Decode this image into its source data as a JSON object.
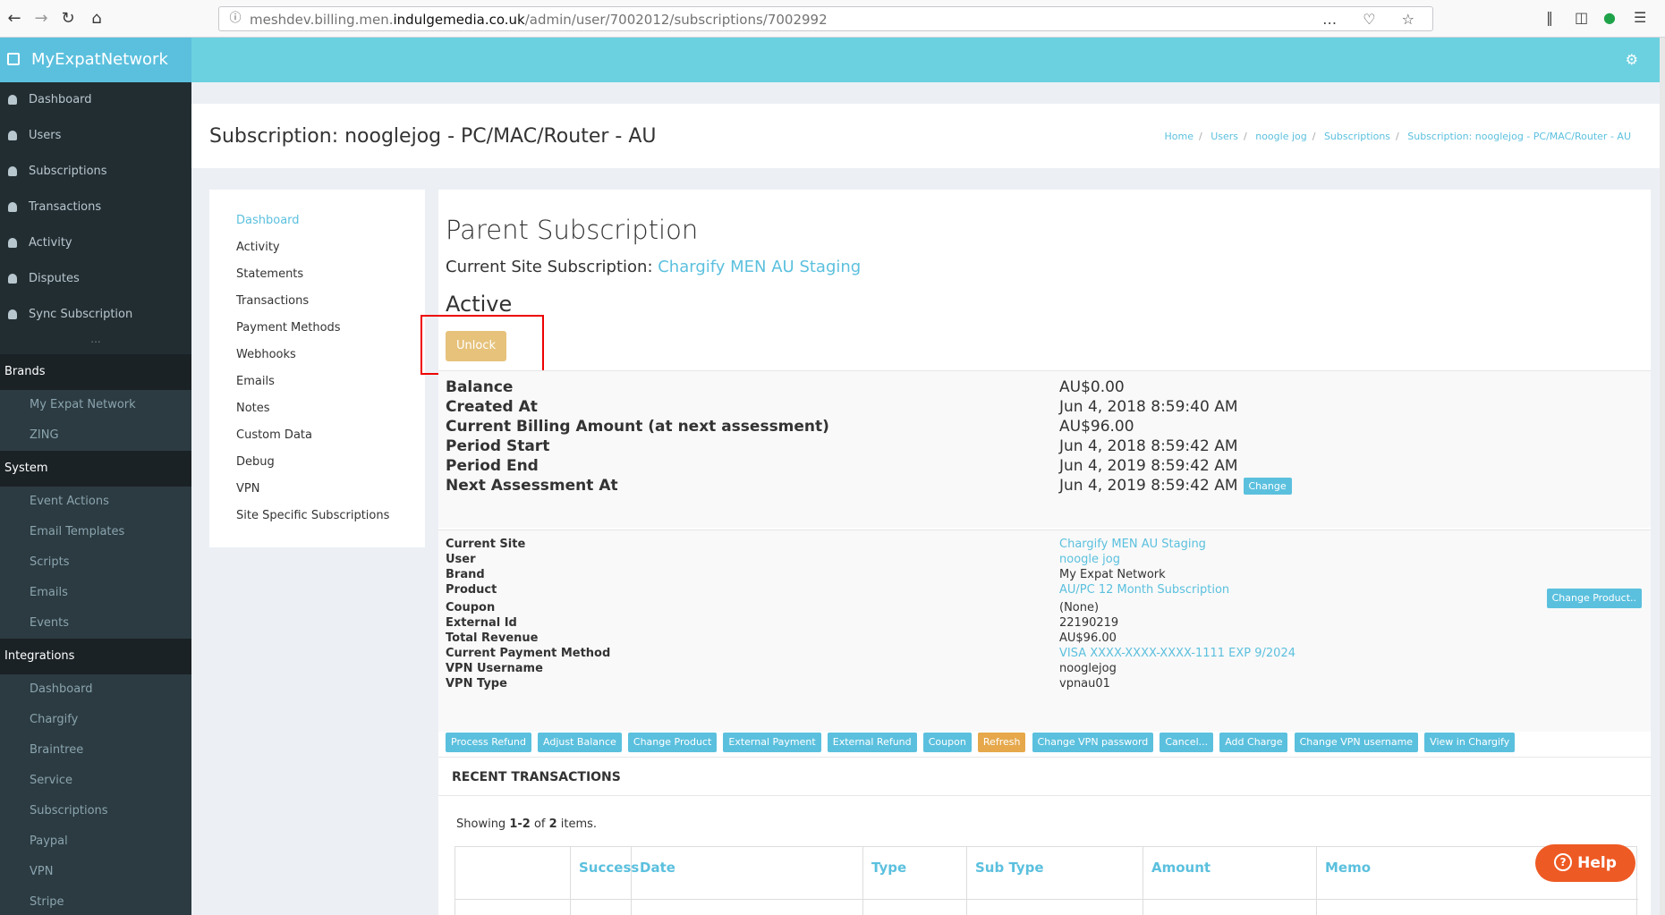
{
  "browser": {
    "url_prefix": "meshdev.billing.men.",
    "url_domain": "indulgemedia.co.uk",
    "url_path": "/admin/user/7002012/subscriptions/7002992",
    "more_icon": "…",
    "pocket_icon": "♡",
    "star_icon": "☆"
  },
  "sidebar": {
    "brand": "MyExpatNetwork",
    "items": [
      "Dashboard",
      "Users",
      "Subscriptions",
      "Transactions",
      "Activity",
      "Disputes",
      "Sync Subscription"
    ],
    "dots": "...",
    "brands_header": "Brands",
    "brands": [
      "My Expat Network",
      "ZING"
    ],
    "system_header": "System",
    "system": [
      "Event Actions",
      "Email Templates",
      "Scripts",
      "Emails",
      "Events"
    ],
    "integrations_header": "Integrations",
    "integrations": [
      "Dashboard",
      "Chargify",
      "Braintree",
      "Service",
      "Subscriptions",
      "Paypal",
      "VPN",
      "Stripe"
    ]
  },
  "header": {
    "title": "Subscription: nooglejog - PC/MAC/Router - AU",
    "breadcrumb": [
      "Home",
      "Users",
      "noogle jog",
      "Subscriptions",
      "Subscription: nooglejog - PC/MAC/Router - AU"
    ],
    "breadcrumb_sep": "/"
  },
  "subnav": [
    "Dashboard",
    "Activity",
    "Statements",
    "Transactions",
    "Payment Methods",
    "Webhooks",
    "Emails",
    "Notes",
    "Custom Data",
    "Debug",
    "VPN",
    "Site Specific Subscriptions"
  ],
  "main": {
    "parent_title": "Parent Subscription",
    "current_site_label": "Current Site Subscription: ",
    "current_site_link": "Chargify MEN AU Staging",
    "status": "Active",
    "unlock_label": "Unlock",
    "summary": [
      {
        "label": "Balance",
        "value": "AU$0.00"
      },
      {
        "label": "Created At",
        "value": "Jun 4, 2018 8:59:40 AM"
      },
      {
        "label": "Current Billing Amount (at next assessment)",
        "value": "AU$96.00"
      },
      {
        "label": "Period Start",
        "value": "Jun 4, 2018 8:59:42 AM"
      },
      {
        "label": "Period End",
        "value": "Jun 4, 2019 8:59:42 AM"
      },
      {
        "label": "Next Assessment At",
        "value": "Jun 4, 2019 8:59:42 AM"
      }
    ],
    "change_label": "Change",
    "details": [
      {
        "label": "Current Site",
        "value": "Chargify MEN AU Staging"
      },
      {
        "label": "User",
        "value": "noogle jog"
      },
      {
        "label": "Brand",
        "value": "My Expat Network"
      },
      {
        "label": "Product",
        "value": "AU/PC 12 Month Subscription"
      },
      {
        "label": "Coupon",
        "value": "(None)"
      },
      {
        "label": "External Id",
        "value": "22190219"
      },
      {
        "label": "Total Revenue",
        "value": "AU$96.00"
      },
      {
        "label": "Current Payment Method",
        "value": "VISA XXXX-XXXX-XXXX-1111 EXP 9/2024"
      },
      {
        "label": "VPN Username",
        "value": "nooglejog"
      },
      {
        "label": "VPN Type",
        "value": "vpnau01"
      }
    ],
    "change_product_label": "Change Product..",
    "actions": [
      "Process Refund",
      "Adjust Balance",
      "Change Product",
      "External Payment",
      "External Refund",
      "Coupon",
      "Refresh",
      "Change VPN password",
      "Cancel...",
      "Add Charge",
      "Change VPN username",
      "View in Chargify"
    ],
    "recent_title": "RECENT TRANSACTIONS",
    "showing_prefix": "Showing ",
    "showing_range": "1-2",
    "showing_of": " of ",
    "showing_total": "2",
    "showing_suffix": " items.",
    "columns": [
      "Success",
      "Date",
      "Type",
      "Sub Type",
      "Amount",
      "Memo"
    ]
  },
  "help_label": "Help",
  "colors": {
    "accent": "#5bc0de",
    "topbar": "#6bd1e0",
    "sidebar": "#222d32",
    "warning": "#e6c27b",
    "help": "#ee5a24"
  }
}
